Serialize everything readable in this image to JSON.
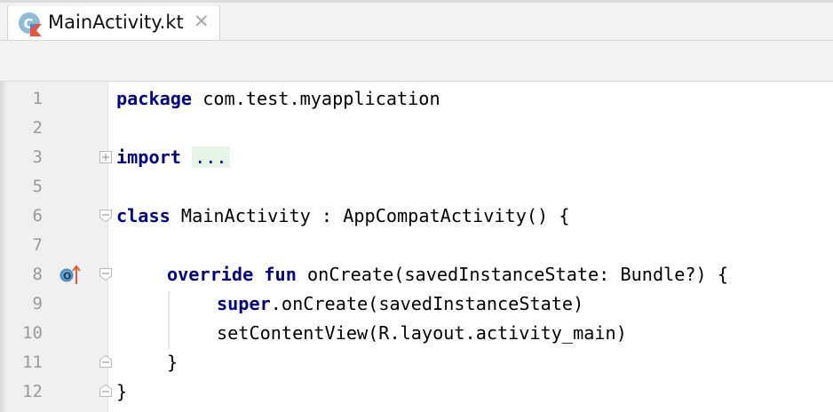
{
  "tab": {
    "title": "MainActivity.kt",
    "close_glyph": "✕",
    "icon": "kotlin-class-icon"
  },
  "editor": {
    "lines": [
      {
        "number": "1",
        "text": ""
      },
      {
        "number": "2",
        "text": ""
      },
      {
        "number": "3",
        "text": ""
      },
      {
        "number": "5",
        "text": ""
      },
      {
        "number": "6",
        "text": ""
      },
      {
        "number": "7",
        "text": ""
      },
      {
        "number": "8",
        "text": ""
      },
      {
        "number": "9",
        "text": ""
      },
      {
        "number": "10",
        "text": ""
      },
      {
        "number": "11",
        "text": ""
      },
      {
        "number": "12",
        "text": ""
      }
    ],
    "code": {
      "l1_kw": "package",
      "l1_rest": " com.test.myapplication",
      "l3_kw": "import",
      "l3_fold": "...",
      "l6_kw": "class",
      "l6_rest": " MainActivity : AppCompatActivity() {",
      "l8_kw1": "override",
      "l8_kw2": "fun",
      "l8_rest": " onCreate(savedInstanceState: Bundle?) {",
      "l9_kw": "super",
      "l9_rest": ".onCreate(savedInstanceState)",
      "l10_rest": "setContentView(R.layout.activity_main)",
      "l11_rest": "}",
      "l12_rest": "}"
    },
    "colors": {
      "keyword": "#000080",
      "line_number": "#999999",
      "fold_highlight": "#e6f5e6",
      "gutter_bg": "#f0f0f0"
    },
    "gutter_icons": [
      "override-method-icon",
      "fold-expand-icon",
      "fold-collapse-icon",
      "fold-end-icon"
    ]
  }
}
